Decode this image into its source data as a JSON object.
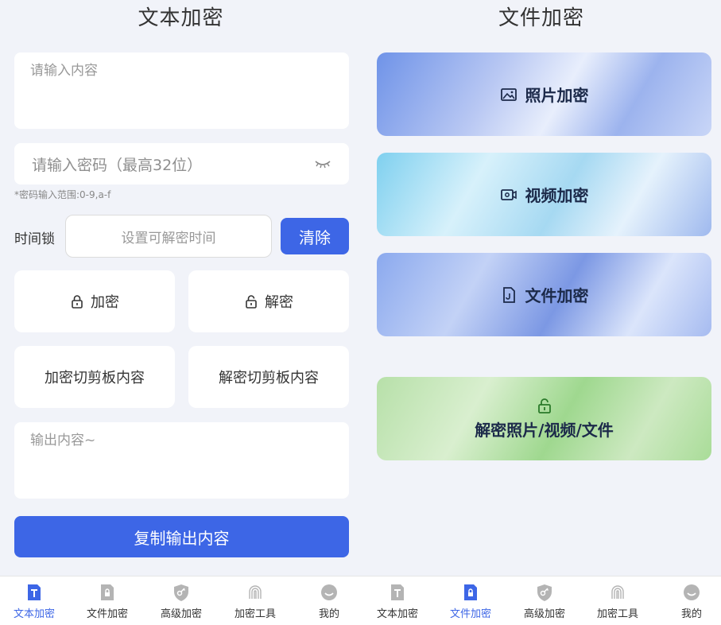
{
  "left": {
    "title": "文本加密",
    "input_placeholder": "请输入内容",
    "password_placeholder": "请输入密码（最高32位）",
    "password_hint": "*密码输入范围:0-9,a-f",
    "time_lock_label": "时间锁",
    "time_placeholder": "设置可解密时间",
    "clear_label": "清除",
    "encrypt_label": "加密",
    "decrypt_label": "解密",
    "encrypt_clipboard_label": "加密切剪板内容",
    "decrypt_clipboard_label": "解密切剪板内容",
    "output_placeholder": "输出内容~",
    "copy_output_label": "复制输出内容"
  },
  "right": {
    "title": "文件加密",
    "tiles": [
      {
        "label": "照片加密",
        "icon": "image-icon"
      },
      {
        "label": "视频加密",
        "icon": "video-icon"
      },
      {
        "label": "文件加密",
        "icon": "file-icon"
      }
    ],
    "decrypt_tile_label": "解密照片/视频/文件"
  },
  "tabbar_left": [
    {
      "label": "文本加密",
      "icon": "text-icon",
      "active": true
    },
    {
      "label": "文件加密",
      "icon": "file-lock-icon",
      "active": false
    },
    {
      "label": "高级加密",
      "icon": "shield-key-icon",
      "active": false
    },
    {
      "label": "加密工具",
      "icon": "fingerprint-icon",
      "active": false
    },
    {
      "label": "我的",
      "icon": "smile-icon",
      "active": false
    }
  ],
  "tabbar_right": [
    {
      "label": "文本加密",
      "icon": "text-icon",
      "active": false
    },
    {
      "label": "文件加密",
      "icon": "file-lock-icon",
      "active": true
    },
    {
      "label": "高级加密",
      "icon": "shield-key-icon",
      "active": false
    },
    {
      "label": "加密工具",
      "icon": "fingerprint-icon",
      "active": false
    },
    {
      "label": "我的",
      "icon": "smile-icon",
      "active": false
    }
  ],
  "colors": {
    "accent": "#3d66e6",
    "background": "#f1f3f9"
  }
}
